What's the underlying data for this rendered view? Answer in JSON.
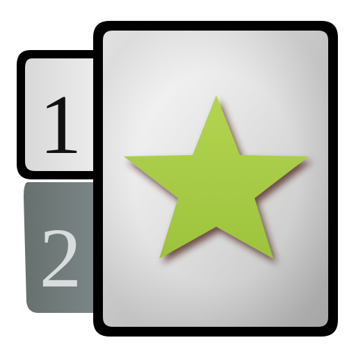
{
  "icon": {
    "tabs": [
      {
        "label": "1",
        "text_color": "#111111",
        "background": "#e0e0e0",
        "state": "active"
      },
      {
        "label": "2",
        "text_color": "#d8dcdc",
        "background": "#6f7a7a",
        "state": "inactive"
      }
    ],
    "card": {
      "symbol": "star-icon",
      "star_color": "#a8cc45",
      "card_gradient": [
        "#ffffff",
        "#c8c8c8"
      ],
      "outline_color": "#000000"
    }
  }
}
